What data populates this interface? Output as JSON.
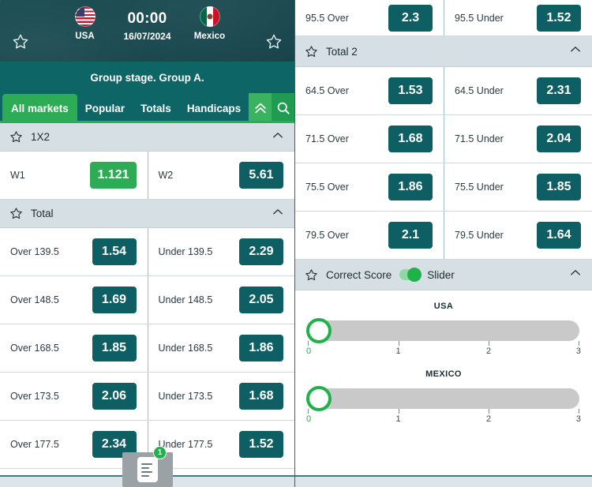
{
  "header": {
    "favorite_left_icon": "star-outline-icon",
    "favorite_right_icon": "star-outline-icon",
    "home_team": "USA",
    "away_team": "Mexico",
    "time": "00:00",
    "date": "16/07/2024",
    "home_flag": "usa-flag-icon",
    "away_flag": "mexico-flag-icon",
    "stage": "Group stage. Group A."
  },
  "tabs": {
    "items": [
      {
        "label": "All markets",
        "active": true
      },
      {
        "label": "Popular",
        "active": false
      },
      {
        "label": "Totals",
        "active": false
      },
      {
        "label": "Handicaps",
        "active": false
      }
    ],
    "collapse_icon": "double-chevron-up-icon",
    "search_icon": "search-icon"
  },
  "left_column": {
    "sections": [
      {
        "title": "1X2",
        "star_icon": "star-outline-icon",
        "chevron_icon": "chevron-up-icon",
        "rows": [
          {
            "left_label": "W1",
            "left_odds": "1.121",
            "left_highlight": true,
            "right_label": "W2",
            "right_odds": "5.61",
            "right_highlight": false
          }
        ]
      },
      {
        "title": "Total",
        "star_icon": "star-outline-icon",
        "chevron_icon": "chevron-up-icon",
        "rows": [
          {
            "left_label": "Over 139.5",
            "left_odds": "1.54",
            "left_highlight": false,
            "right_label": "Under 139.5",
            "right_odds": "2.29",
            "right_highlight": false
          },
          {
            "left_label": "Over 148.5",
            "left_odds": "1.69",
            "left_highlight": false,
            "right_label": "Under 148.5",
            "right_odds": "2.05",
            "right_highlight": false
          },
          {
            "left_label": "Over 168.5",
            "left_odds": "1.85",
            "left_highlight": false,
            "right_label": "Under 168.5",
            "right_odds": "1.86",
            "right_highlight": false
          },
          {
            "left_label": "Over 173.5",
            "left_odds": "2.06",
            "left_highlight": false,
            "right_label": "Under 173.5",
            "right_odds": "1.68",
            "right_highlight": false
          },
          {
            "left_label": "Over 177.5",
            "left_odds": "2.34",
            "left_highlight": false,
            "right_label": "Under 177.5",
            "right_odds": "1.52",
            "right_highlight": false
          }
        ]
      }
    ]
  },
  "right_column": {
    "top_row": {
      "left_label": "95.5 Over",
      "left_odds": "2.3",
      "right_label": "95.5 Under",
      "right_odds": "1.52"
    },
    "total2": {
      "title": "Total 2",
      "star_icon": "star-outline-icon",
      "chevron_icon": "chevron-up-icon",
      "rows": [
        {
          "left_label": "64.5 Over",
          "left_odds": "1.53",
          "right_label": "64.5 Under",
          "right_odds": "2.31"
        },
        {
          "left_label": "71.5 Over",
          "left_odds": "1.68",
          "right_label": "71.5 Under",
          "right_odds": "2.04"
        },
        {
          "left_label": "75.5 Over",
          "left_odds": "1.86",
          "right_label": "75.5 Under",
          "right_odds": "1.85"
        },
        {
          "left_label": "79.5 Over",
          "left_odds": "2.1",
          "right_label": "79.5 Under",
          "right_odds": "1.64"
        }
      ]
    },
    "correct_score": {
      "title": "Correct Score",
      "toggle_label": "Slider",
      "toggle_on": true,
      "star_icon": "star-outline-icon",
      "chevron_icon": "chevron-up-icon",
      "sliders": [
        {
          "team": "USA",
          "value": 0,
          "min": 0,
          "max": 3,
          "ticks": [
            "0",
            "1",
            "2",
            "3"
          ]
        },
        {
          "team": "MEXICO",
          "value": 0,
          "min": 0,
          "max": 3,
          "ticks": [
            "0",
            "1",
            "2",
            "3"
          ]
        }
      ]
    }
  },
  "betslip": {
    "count": "1",
    "icon": "betslip-card-icon"
  },
  "colors": {
    "banner_teal": "#1b4b51",
    "stage_teal": "#0d6565",
    "accent_green": "#2eab55",
    "odds_teal": "#0d5f63",
    "section_header": "#d6e0e4",
    "slider_track": "#c9c9c9",
    "slider_knob_green": "#1fb14a"
  }
}
